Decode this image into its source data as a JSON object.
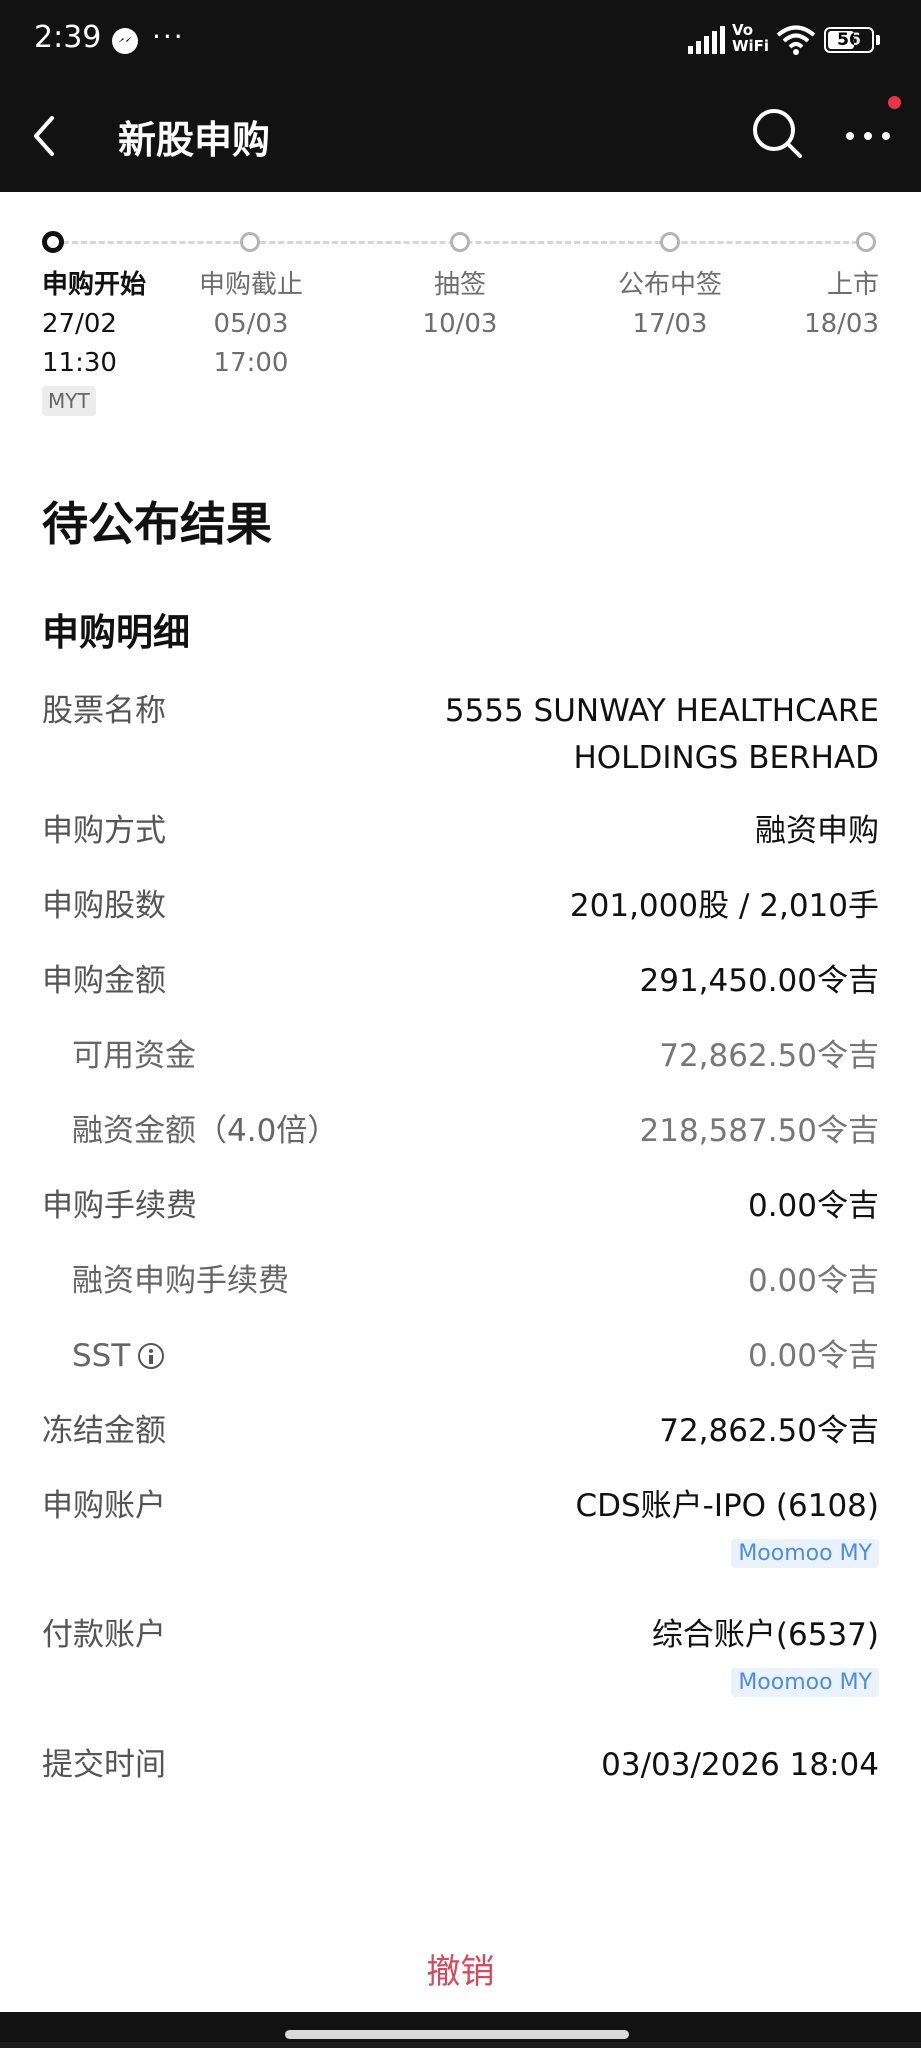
{
  "status_bar": {
    "time": "2:39",
    "more": "···",
    "network_label": "Vo\nWiFi",
    "battery": "56"
  },
  "header": {
    "title": "新股申购"
  },
  "timeline": {
    "steps": [
      {
        "name": "申购开始",
        "date": "27/02",
        "time": "11:30"
      },
      {
        "name": "申购截止",
        "date": "05/03",
        "time": "17:00"
      },
      {
        "name": "抽签",
        "date": "10/03"
      },
      {
        "name": "公布中签",
        "date": "17/03"
      },
      {
        "name": "上市",
        "date": "18/03"
      }
    ],
    "timezone": "MYT"
  },
  "result_status": "待公布结果",
  "details": {
    "section_title": "申购明细",
    "stock_name": {
      "label": "股票名称",
      "line1": "5555 SUNWAY HEALTHCARE",
      "line2": "HOLDINGS BERHAD"
    },
    "method": {
      "label": "申购方式",
      "value": "融资申购"
    },
    "shares": {
      "label": "申购股数",
      "value": "201,000股 / 2,010手"
    },
    "amount": {
      "label": "申购金额",
      "value": "291,450.00令吉"
    },
    "available_funds": {
      "label": "可用资金",
      "value": "72,862.50令吉"
    },
    "financing_amount": {
      "label": "融资金额（4.0倍）",
      "value": "218,587.50令吉"
    },
    "fee": {
      "label": "申购手续费",
      "value": "0.00令吉"
    },
    "financing_fee": {
      "label": "融资申购手续费",
      "value": "0.00令吉"
    },
    "sst": {
      "label": "SST",
      "value": "0.00令吉"
    },
    "frozen": {
      "label": "冻结金额",
      "value": "72,862.50令吉"
    },
    "subscription_account": {
      "label": "申购账户",
      "value": "CDS账户-IPO (6108)",
      "tag": "Moomoo MY"
    },
    "payment_account": {
      "label": "付款账户",
      "value": "综合账户(6537)",
      "tag": "Moomoo MY"
    },
    "submit_time": {
      "label": "提交时间",
      "value": "03/03/2026 18:04"
    }
  },
  "cancel_label": "撤销",
  "colors": {
    "header_bg": "#121212",
    "cancel": "#d8475d",
    "account_tag": "#4f8de0",
    "notification_dot": "#e8344a"
  },
  "icons": [
    "messenger-icon",
    "signal-icon",
    "wifi-icon",
    "battery-icon",
    "back-arrow-icon",
    "search-icon",
    "more-icon",
    "info-icon"
  ]
}
